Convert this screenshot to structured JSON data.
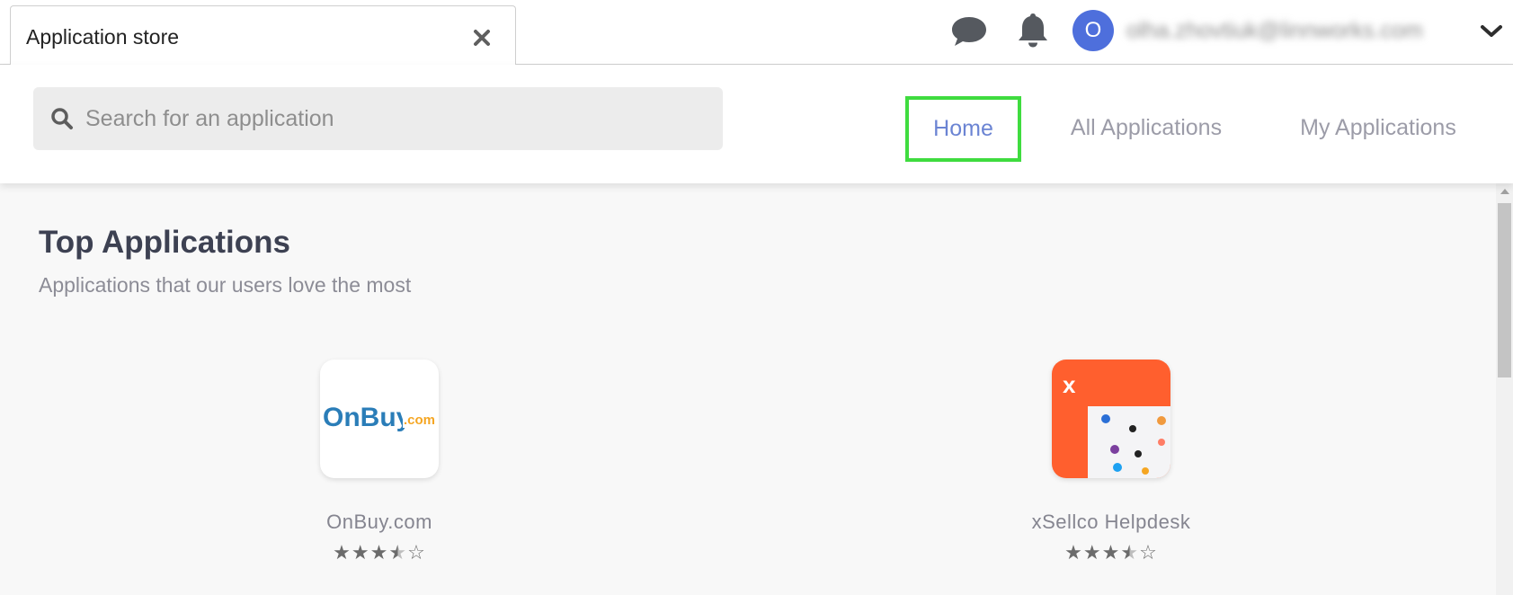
{
  "tab": {
    "title": "Application store"
  },
  "user": {
    "avatar_initial": "O",
    "email": "olha.zhovtiuk@linnworks.com"
  },
  "search": {
    "placeholder": "Search for an application",
    "value": ""
  },
  "nav": {
    "tabs": [
      {
        "label": "Home",
        "active": true
      },
      {
        "label": "All Applications",
        "active": false
      },
      {
        "label": "My Applications",
        "active": false
      }
    ]
  },
  "section": {
    "title": "Top Applications",
    "subtitle": "Applications that our users love the most"
  },
  "apps": [
    {
      "name": "OnBuy.com",
      "rating": 3.5,
      "logo_text": "OnBuy",
      "logo_suffix": ".com"
    },
    {
      "name": "xSellco Helpdesk",
      "rating": 3.5,
      "logo_text": "x"
    }
  ],
  "colors": {
    "accent": "#6b84d3",
    "highlight": "#3fdc3f",
    "avatar": "#4e6fdc",
    "xsellco": "#ff5f2e",
    "onbuy_blue": "#2a7db8",
    "onbuy_orange": "#f5a623"
  },
  "icons": [
    "close-icon",
    "chat-icon",
    "bell-icon",
    "chevron-down-icon",
    "search-icon",
    "star-icon"
  ]
}
